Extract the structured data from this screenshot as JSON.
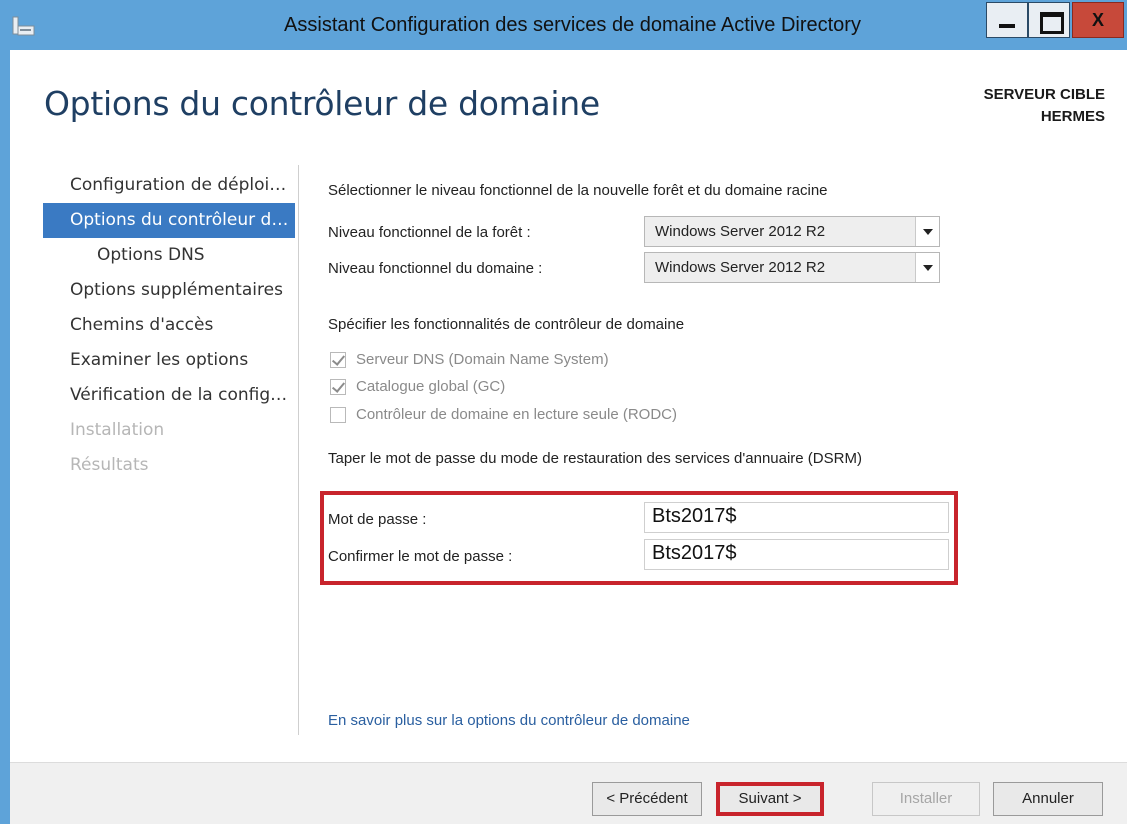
{
  "window": {
    "title": "Assistant Configuration des services de domaine Active Directory",
    "controls": {
      "minimize": "_",
      "maximize": "□",
      "close": "X"
    },
    "accent_color": "#5ea3d9"
  },
  "header": {
    "page_title": "Options du contrôleur de domaine",
    "target_label": "SERVEUR CIBLE",
    "target_name": "HERMES"
  },
  "nav": {
    "items": [
      {
        "label": "Configuration de déploiement",
        "state": "normal"
      },
      {
        "label": "Options du contrôleur de domaine",
        "state": "active"
      },
      {
        "label": "Options DNS",
        "state": "sub"
      },
      {
        "label": "Options supplémentaires",
        "state": "normal"
      },
      {
        "label": "Chemins d'accès",
        "state": "normal"
      },
      {
        "label": "Examiner les options",
        "state": "normal"
      },
      {
        "label": "Vérification de la configuration requise",
        "state": "normal"
      },
      {
        "label": "Installation",
        "state": "disabled"
      },
      {
        "label": "Résultats",
        "state": "disabled"
      }
    ],
    "active_color": "#3a7ac3"
  },
  "content": {
    "functional_level_title": "Sélectionner le niveau fonctionnel de la nouvelle forêt et du domaine racine",
    "forest_level_label": "Niveau fonctionnel de la forêt :",
    "forest_level_value": "Windows Server 2012 R2",
    "domain_level_label": "Niveau fonctionnel du domaine :",
    "domain_level_value": "Windows Server 2012 R2",
    "capabilities_title": "Spécifier les fonctionnalités de contrôleur de domaine",
    "capabilities": [
      {
        "label": "Serveur DNS (Domain Name System)",
        "checked": true
      },
      {
        "label": "Catalogue global (GC)",
        "checked": true
      },
      {
        "label": "Contrôleur de domaine en lecture seule (RODC)",
        "checked": false
      }
    ],
    "dsrm_title": "Taper le mot de passe du mode de restauration des services d'annuaire (DSRM)",
    "password_label": "Mot de passe :",
    "password_value": "Bts2017$",
    "confirm_label": "Confirmer le mot de passe :",
    "confirm_value": "Bts2017$",
    "highlight_color": "#c8242c",
    "learn_more_link": "En savoir plus sur la options du contrôleur de domaine"
  },
  "footer": {
    "previous_label": "< Précédent",
    "next_label": "Suivant >",
    "install_label": "Installer",
    "cancel_label": "Annuler"
  }
}
